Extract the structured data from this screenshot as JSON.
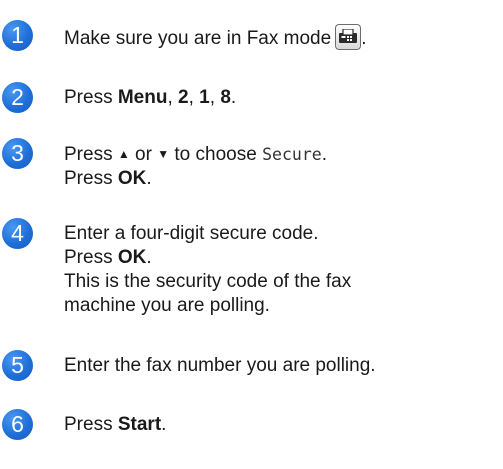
{
  "steps": [
    {
      "number": "1",
      "line1": "Make sure you are in Fax mode",
      "icon": "fax-mode-icon"
    },
    {
      "number": "2",
      "press": "Press",
      "keys": [
        "Menu",
        "2",
        "1",
        "8"
      ],
      "comma": ",",
      "end": "."
    },
    {
      "number": "3",
      "press": "Press",
      "up": "▲",
      "or": "or",
      "down": "▼",
      "to_choose": "to choose",
      "option": "Secure",
      "end": ".",
      "press2": "Press",
      "ok": "OK",
      "end2": "."
    },
    {
      "number": "4",
      "line1": "Enter a four-digit secure code.",
      "press": "Press",
      "ok": "OK",
      "end": ".",
      "line3": "This is the security code of the fax",
      "line4": "machine you are polling."
    },
    {
      "number": "5",
      "line1": "Enter the fax number you are polling."
    },
    {
      "number": "6",
      "press": "Press",
      "start": "Start",
      "end": "."
    }
  ],
  "colors": {
    "badge": "#1f6fd8",
    "text": "#1a1a1a"
  }
}
